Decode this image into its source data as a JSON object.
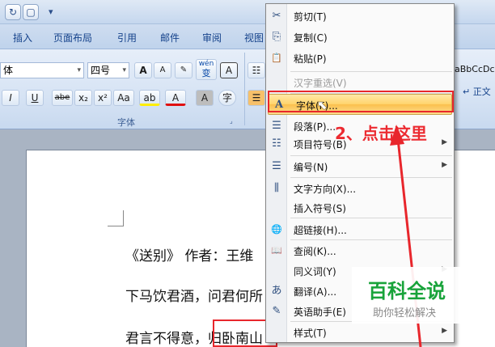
{
  "qat": {
    "buttons": [
      {
        "icon": "redo-icon",
        "glyph": "↻"
      },
      {
        "icon": "new-document-icon",
        "glyph": "▢"
      },
      {
        "icon": "customize-dropdown-icon",
        "glyph": "▾"
      }
    ]
  },
  "ribbon_tabs": [
    "插入",
    "页面布局",
    "引用",
    "邮件",
    "审阅",
    "视图"
  ],
  "ribbon": {
    "font_name": "体",
    "font_size": "四号",
    "font_group_label": "字体",
    "styles_preview": "aBbCcDc",
    "style_normal": "正文",
    "grow_font": "A",
    "shrink_font": "A",
    "change_case": "Aa",
    "bold": "I",
    "underline": "U",
    "strikethrough": "abe",
    "subscript": "x₂",
    "superscript": "x²",
    "highlight": "ab",
    "font_color": "A",
    "char_shading": "A",
    "phonetic": "wén",
    "phonetic_sub": "变",
    "char_border": "A",
    "enclose": "字"
  },
  "colors": {
    "accent": "#e8262c",
    "menu_highlight": "#ffd36b",
    "ribbon_text": "#15428b"
  },
  "document": {
    "lines": [
      "《送别》 作者：王维",
      "下马饮君酒，问君何所",
      "君言不得意，归卧南山"
    ]
  },
  "context_menu": {
    "items": [
      {
        "label": "剪切(T)",
        "icon": "scissors-icon",
        "glyph": "✂",
        "enabled": true
      },
      {
        "label": "复制(C)",
        "icon": "copy-icon",
        "glyph": "⎘",
        "enabled": true
      },
      {
        "label": "粘贴(P)",
        "icon": "paste-icon",
        "glyph": "📋",
        "enabled": true
      },
      {
        "label": "汉字重选(V)",
        "icon": "",
        "glyph": "",
        "enabled": false
      },
      {
        "label": "字体(F)...",
        "icon": "font-icon",
        "glyph": "A",
        "enabled": true,
        "highlighted": true
      },
      {
        "label": "段落(P)...",
        "icon": "paragraph-icon",
        "glyph": "☰",
        "enabled": true
      },
      {
        "label": "项目符号(B)",
        "icon": "bullets-icon",
        "glyph": "☷",
        "enabled": true,
        "submenu": true
      },
      {
        "label": "编号(N)",
        "icon": "numbering-icon",
        "glyph": "☰",
        "enabled": true,
        "submenu": true
      },
      {
        "label": "文字方向(X)...",
        "icon": "text-direction-icon",
        "glyph": "⫼",
        "enabled": true
      },
      {
        "label": "插入符号(S)",
        "icon": "",
        "glyph": "",
        "enabled": true
      },
      {
        "label": "超链接(H)...",
        "icon": "hyperlink-icon",
        "glyph": "🌐",
        "enabled": true
      },
      {
        "label": "查阅(K)...",
        "icon": "research-icon",
        "glyph": "📖",
        "enabled": true
      },
      {
        "label": "同义词(Y)",
        "icon": "",
        "glyph": "",
        "enabled": true,
        "submenu": true
      },
      {
        "label": "翻译(A)...",
        "icon": "translate-icon",
        "glyph": "あ",
        "enabled": true
      },
      {
        "label": "英语助手(E)",
        "icon": "english-assistant-icon",
        "glyph": "✎",
        "enabled": true
      },
      {
        "label": "样式(T)",
        "icon": "",
        "glyph": "",
        "enabled": true,
        "submenu": true
      }
    ]
  },
  "annotation": {
    "note": "2、点击这里"
  },
  "watermark": {
    "brand": "百科全说",
    "slogan": "助你轻松解决"
  }
}
